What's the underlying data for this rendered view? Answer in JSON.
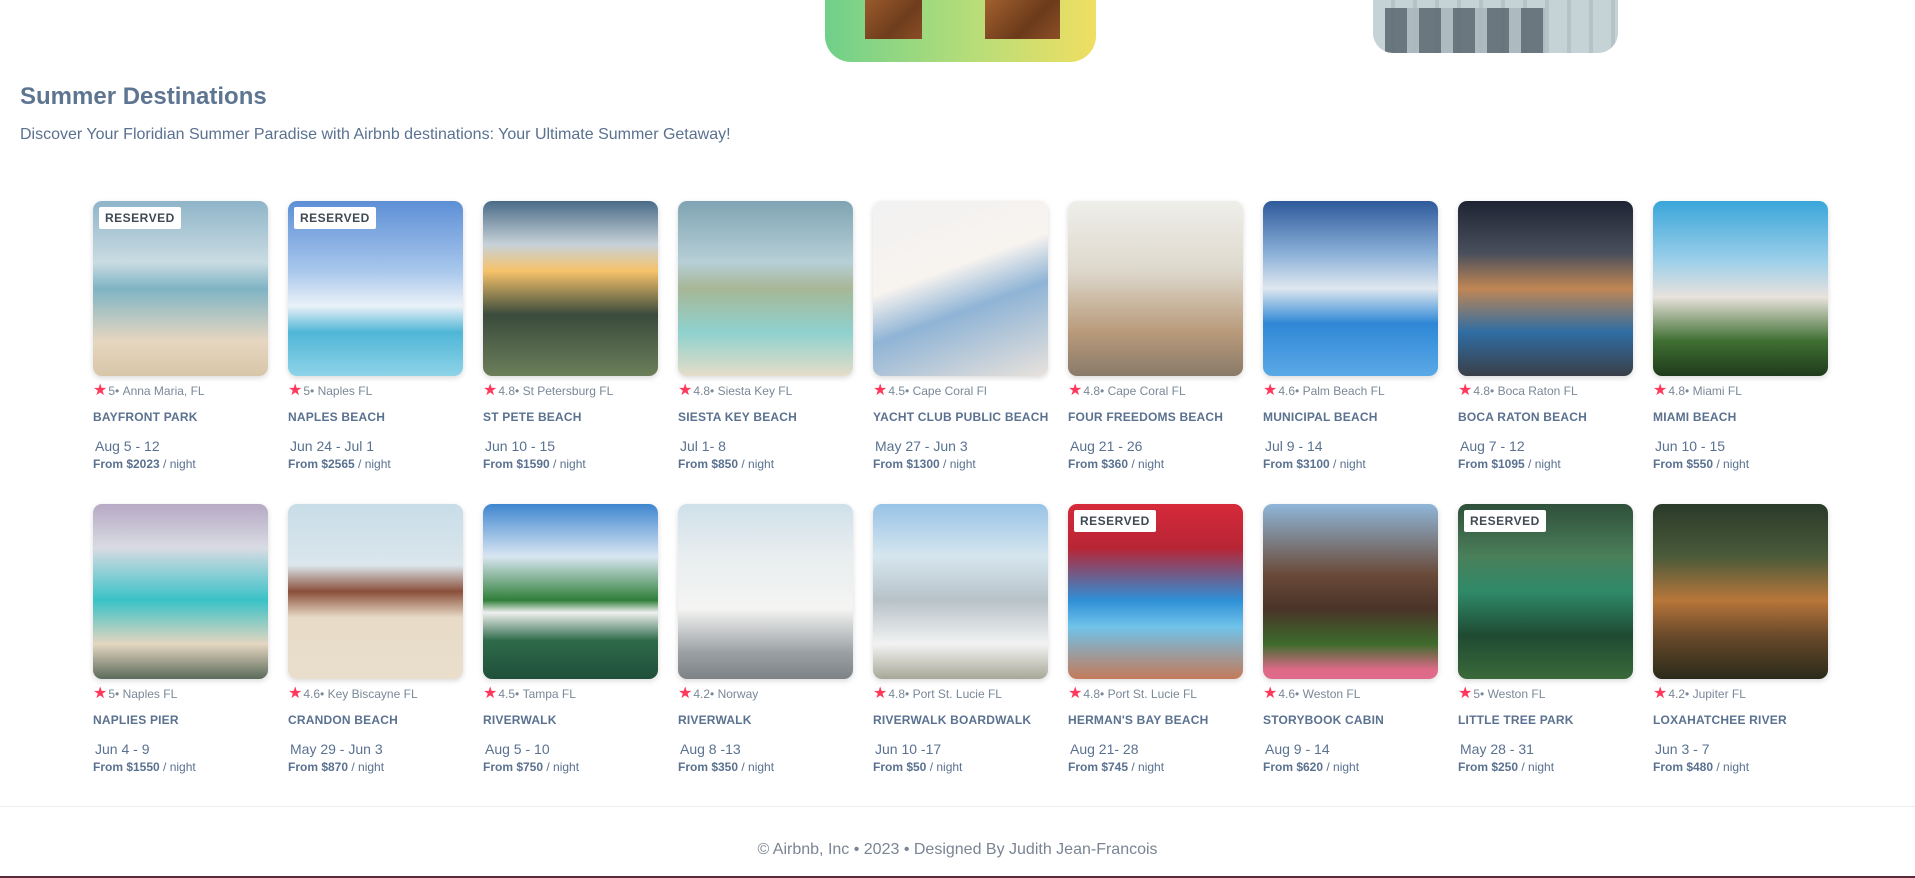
{
  "section": {
    "title": "Summer Destinations",
    "subtitle": "Discover Your Floridian Summer Paradise with Airbnb destinations: Your Ultimate Summer Getaway!"
  },
  "accent_color": "#ff385c",
  "listings": [
    {
      "reserved": "RESERVED",
      "rating": "5•",
      "location": "Anna Maria, FL",
      "name": "BAYFRONT PARK",
      "dates": "Aug 5 - 12",
      "price": "From $2023",
      "unit": "/ night"
    },
    {
      "reserved": "RESERVED",
      "rating": "5•",
      "location": "Naples FL",
      "name": "NAPLES BEACH",
      "dates": "Jun 24 - Jul 1",
      "price": "From $2565",
      "unit": "/ night"
    },
    {
      "reserved": "",
      "rating": "4.8•",
      "location": "St Petersburg FL",
      "name": "ST PETE BEACH",
      "dates": "Jun 10 - 15",
      "price": "From $1590",
      "unit": "/ night"
    },
    {
      "reserved": "",
      "rating": "4.8•",
      "location": "Siesta Key FL",
      "name": "SIESTA KEY BEACH",
      "dates": "Jul 1- 8",
      "price": "From $850",
      "unit": "/ night"
    },
    {
      "reserved": "",
      "rating": "4.5•",
      "location": "Cape Coral Fl",
      "name": "YACHT CLUB PUBLIC BEACH",
      "dates": "May 27 - Jun 3",
      "price": "From $1300",
      "unit": "/ night"
    },
    {
      "reserved": "",
      "rating": "4.8•",
      "location": "Cape Coral FL",
      "name": "FOUR FREEDOMS BEACH",
      "dates": "Aug 21 - 26",
      "price": "From $360",
      "unit": "/ night"
    },
    {
      "reserved": "",
      "rating": "4.6•",
      "location": "Palm Beach FL",
      "name": "MUNICIPAL BEACH",
      "dates": "Jul 9 - 14",
      "price": "From $3100",
      "unit": "/ night"
    },
    {
      "reserved": "",
      "rating": "4.8•",
      "location": "Boca Raton FL",
      "name": "BOCA RATON BEACH",
      "dates": "Aug 7 - 12",
      "price": "From $1095",
      "unit": "/ night"
    },
    {
      "reserved": "",
      "rating": "4.8•",
      "location": "Miami FL",
      "name": "MIAMI BEACH",
      "dates": "Jun 10 - 15",
      "price": "From $550",
      "unit": "/ night"
    },
    {
      "reserved": "",
      "rating": "5•",
      "location": "Naples FL",
      "name": "NAPLIES PIER",
      "dates": "Jun 4 - 9",
      "price": "From $1550",
      "unit": "/ night"
    },
    {
      "reserved": "",
      "rating": "4.6•",
      "location": "Key Biscayne FL",
      "name": "CRANDON BEACH",
      "dates": "May 29 - Jun 3",
      "price": "From $870",
      "unit": "/ night"
    },
    {
      "reserved": "",
      "rating": "4.5•",
      "location": "Tampa FL",
      "name": "RIVERWALK",
      "dates": "Aug 5 - 10",
      "price": "From $750",
      "unit": "/ night"
    },
    {
      "reserved": "",
      "rating": "4.2•",
      "location": "Norway",
      "name": "RIVERWALK",
      "dates": "Aug 8 -13",
      "price": "From $350",
      "unit": "/ night"
    },
    {
      "reserved": "",
      "rating": "4.8•",
      "location": "Port St. Lucie FL",
      "name": "RIVERWALK BOARDWALK",
      "dates": "Jun 10 -17",
      "price": "From $50",
      "unit": "/ night"
    },
    {
      "reserved": "RESERVED",
      "rating": "4.8•",
      "location": "Port St. Lucie FL",
      "name": "HERMAN'S BAY BEACH",
      "dates": "Aug 21- 28",
      "price": "From $745",
      "unit": "/ night"
    },
    {
      "reserved": "",
      "rating": "4.6•",
      "location": "Weston FL",
      "name": "STORYBOOK CABIN",
      "dates": "Aug 9 - 14",
      "price": "From $620",
      "unit": "/ night"
    },
    {
      "reserved": "RESERVED",
      "rating": "5•",
      "location": "Weston FL",
      "name": "LITTLE TREE PARK",
      "dates": "May 28 - 31",
      "price": "From $250",
      "unit": "/ night"
    },
    {
      "reserved": "",
      "rating": "4.2•",
      "location": "Jupiter FL",
      "name": "LOXAHATCHEE RIVER",
      "dates": "Jun 3 - 7",
      "price": "From $480",
      "unit": "/ night"
    }
  ],
  "footer": {
    "text": "© Airbnb, Inc • 2023 • Designed By Judith Jean-Francois"
  }
}
